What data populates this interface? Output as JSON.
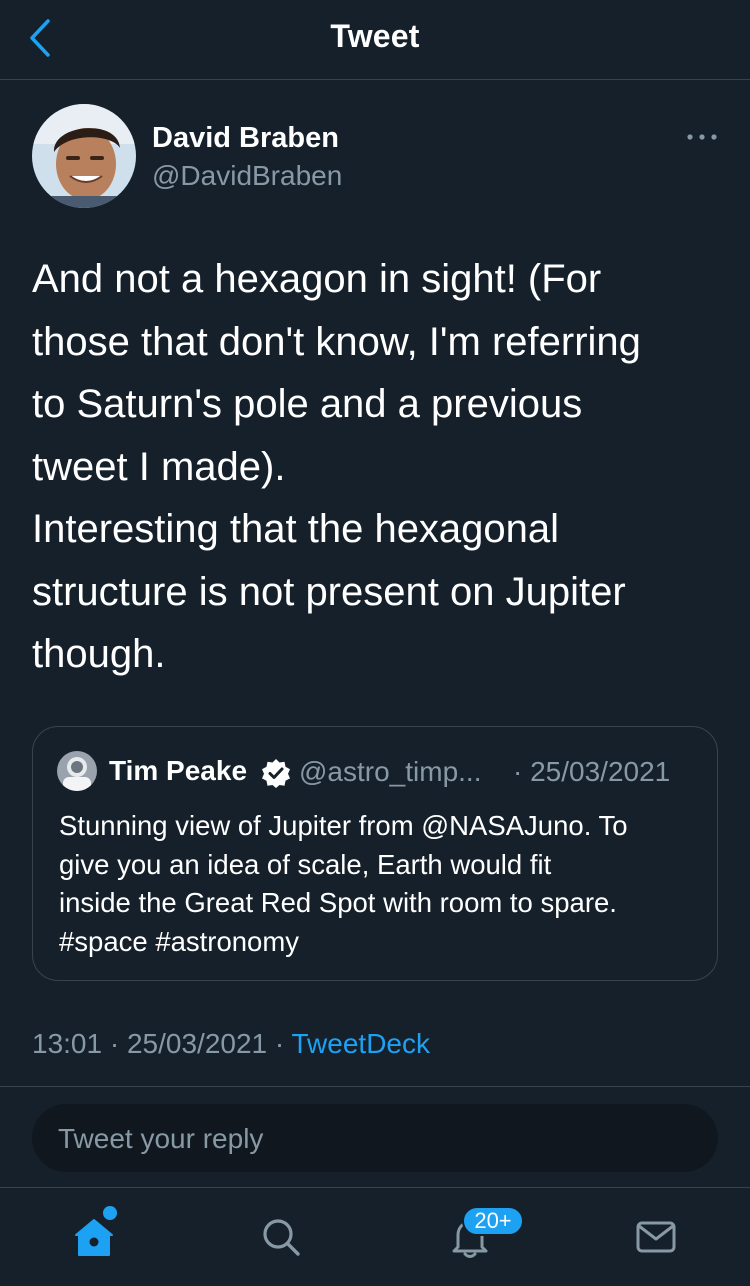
{
  "header": {
    "title": "Tweet"
  },
  "tweet": {
    "author_name": "David Braben",
    "author_handle": "@DavidBraben",
    "text": "And not a hexagon in sight! (For\nthose that don't know, I'm referring\nto Saturn's pole and a previous\ntweet I made).\nInteresting that the hexagonal\nstructure is not present on Jupiter\nthough.",
    "time": "13:01",
    "date": "25/03/2021",
    "source": "TweetDeck"
  },
  "quoted_tweet": {
    "author_name": "Tim Peake",
    "author_handle": "@astro_timp...",
    "date": "· 25/03/2021",
    "text": "Stunning view of Jupiter from @NASAJuno. To\ngive you an idea of scale, Earth would fit\ninside the Great Red Spot with room to spare.\n#space #astronomy"
  },
  "reply": {
    "placeholder": "Tweet your reply"
  },
  "tabbar": {
    "notifications_badge": "20+"
  },
  "colors": {
    "background": "#15202b",
    "accent": "#1da1f2",
    "secondary_text": "#8899a6",
    "border": "#38444d"
  },
  "icons": [
    "back-chevron-icon",
    "more-icon",
    "verified-icon",
    "home-icon",
    "search-icon",
    "bell-icon",
    "mail-icon"
  ]
}
